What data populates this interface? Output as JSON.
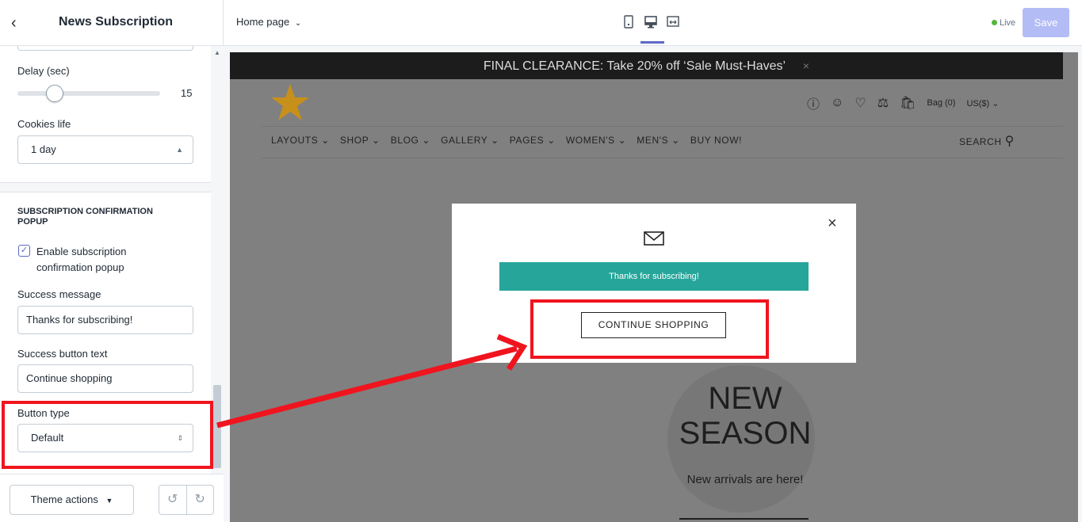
{
  "sidebar": {
    "back_icon": "chevron-left-icon",
    "title": "News Subscription",
    "delay": {
      "label": "Delay (sec)",
      "value": "15",
      "fraction": 0.2
    },
    "cookies": {
      "label": "Cookies life",
      "value": "1 day"
    },
    "confirmation_section": {
      "title": "SUBSCRIPTION CONFIRMATION POPUP",
      "enable_label": "Enable subscription confirmation popup",
      "enable_checked": true,
      "success_message_label": "Success message",
      "success_message_value": "Thanks for subscribing!",
      "success_button_label": "Success button text",
      "success_button_value": "Continue shopping",
      "button_type_label": "Button type",
      "button_type_value": "Default"
    },
    "footer": {
      "theme_actions": "Theme actions"
    }
  },
  "topbar": {
    "page": "Home page",
    "devices": [
      "mobile-icon",
      "desktop-icon",
      "fullscreen-icon"
    ],
    "active_device": "desktop-icon",
    "status": "Live",
    "save": "Save"
  },
  "store": {
    "announcement": "FINAL CLEARANCE: Take 20% off ‘Sale Must-Haves’",
    "announcement_close": "×",
    "header": {
      "bag": "Bag (0)",
      "currency": "US($)"
    },
    "menu": [
      "LAYOUTS",
      "SHOP",
      "BLOG",
      "GALLERY",
      "PAGES",
      "WOMEN'S",
      "MEN'S",
      "BUY NOW!"
    ],
    "menu_dropdown": [
      true,
      true,
      true,
      true,
      true,
      true,
      true,
      false
    ],
    "search": "SEARCH",
    "hero": {
      "title_line1": "NEW",
      "title_line2": "SEASON",
      "subtitle": "New arrivals are here!"
    },
    "popup": {
      "close": "×",
      "message": "Thanks for subscribing!",
      "button": "CONTINUE SHOPPING"
    }
  },
  "colors": {
    "accent": "#5c6ac4",
    "save_disabled": "#b3bcf5",
    "live": "#50b83c",
    "popup_message_bg": "#26a69a",
    "annotation": "#f0141e",
    "overlay": "#808080",
    "star": "#c7901a"
  }
}
